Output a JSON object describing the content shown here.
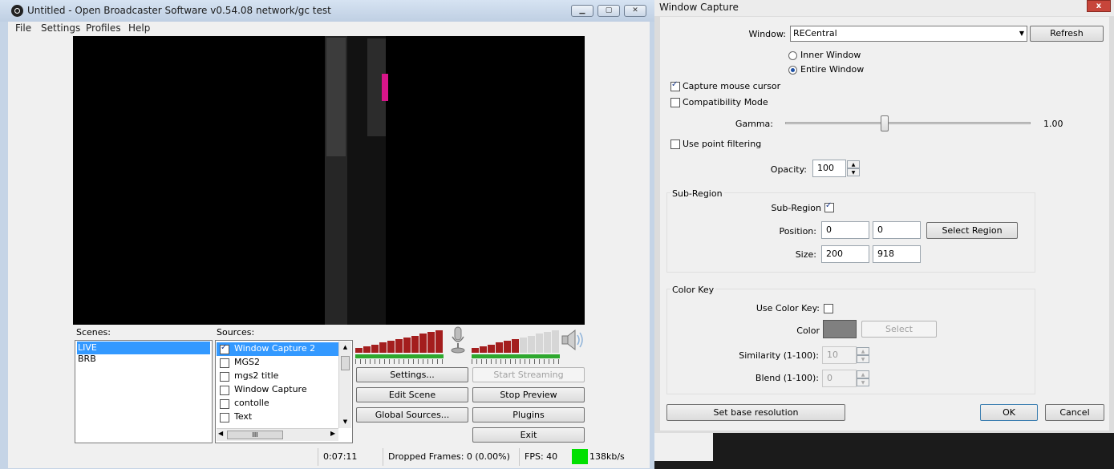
{
  "obs": {
    "title": "Untitled - Open Broadcaster Software v0.54.08 network/gc test",
    "window_buttons": [
      "▁",
      "▢",
      "✕"
    ],
    "menu": [
      "File",
      "Settings",
      "Profiles",
      "Help"
    ],
    "scenes_label": "Scenes:",
    "scenes": [
      {
        "label": "LIVE",
        "selected": true
      },
      {
        "label": "BRB",
        "selected": false
      }
    ],
    "sources_label": "Sources:",
    "sources": [
      {
        "label": "Window Capture 2",
        "checked": true,
        "selected": true
      },
      {
        "label": "MGS2",
        "checked": false,
        "selected": false
      },
      {
        "label": "mgs2 title",
        "checked": false,
        "selected": false
      },
      {
        "label": "Window Capture",
        "checked": false,
        "selected": false
      },
      {
        "label": "contolle",
        "checked": false,
        "selected": false
      },
      {
        "label": "Text",
        "checked": false,
        "selected": false
      }
    ],
    "scroll_grip": "III",
    "buttons": {
      "settings": "Settings...",
      "start_streaming": "Start Streaming",
      "edit_scene": "Edit Scene",
      "stop_preview": "Stop Preview",
      "global_sources": "Global Sources...",
      "plugins": "Plugins",
      "exit": "Exit"
    },
    "status": {
      "time": "0:07:11",
      "dropped_frames": "Dropped Frames: 0 (0.00%)",
      "fps": "FPS: 40",
      "bitrate": "138kb/s",
      "bitrate_color": "#00e000"
    },
    "mic_volume": 1.0,
    "desktop_volume": 0.55,
    "meter_color": "#a41e1e"
  },
  "dialog": {
    "title": "Window Capture",
    "close_label": "x",
    "window_label": "Window:",
    "window_value": "RECentral",
    "refresh": "Refresh",
    "inner_window": "Inner Window",
    "entire_window": "Entire Window",
    "capture_mode_selected": "Entire Window",
    "capture_mouse_cursor": "Capture mouse cursor",
    "capture_mouse_cursor_checked": true,
    "compatibility_mode": "Compatibility Mode",
    "compatibility_mode_checked": false,
    "gamma_label": "Gamma:",
    "gamma_value": "1.00",
    "use_point_filtering": "Use point filtering",
    "use_point_filtering_checked": false,
    "opacity_label": "Opacity:",
    "opacity_value": "100",
    "subregion": {
      "group_title": "Sub-Region",
      "checkbox_label": "Sub-Region",
      "checked": true,
      "position_label": "Position:",
      "pos_x": "0",
      "pos_y": "0",
      "select_region": "Select Region",
      "size_label": "Size:",
      "width": "200",
      "height": "918"
    },
    "color_key": {
      "group_title": "Color Key",
      "use_label": "Use Color Key:",
      "checked": false,
      "color_label": "Color",
      "color_swatch": "#808080",
      "select": "Select",
      "similarity_label": "Similarity (1-100):",
      "similarity_value": "10",
      "blend_label": "Blend (1-100):",
      "blend_value": "0"
    },
    "set_base_resolution": "Set base resolution",
    "ok": "OK",
    "cancel": "Cancel"
  }
}
